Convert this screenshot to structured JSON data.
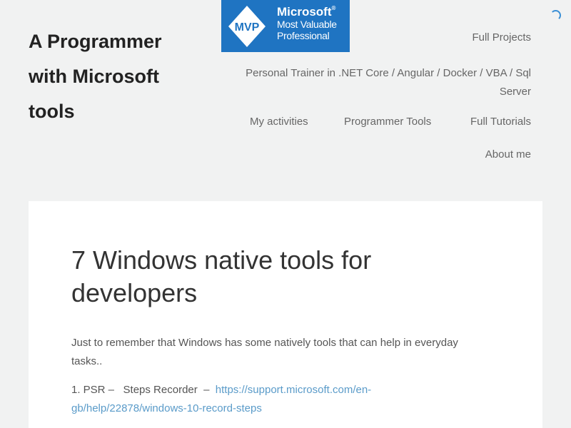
{
  "site": {
    "title": "A Programmer with Microsoft tools"
  },
  "badge": {
    "mvp": "MVP",
    "brand": "Microsoft",
    "reg": "®",
    "line1": "Most Valuable",
    "line2": "Professional",
    "color": "#1f74c2"
  },
  "nav": {
    "full_projects": "Full Projects",
    "trainer": "Personal Trainer in .NET Core / Angular / Docker / VBA / Sql Server",
    "my_activities": "My activities",
    "programmer_tools": "Programmer Tools",
    "full_tutorials": "Full Tutorials",
    "about_me": "About me"
  },
  "post": {
    "title": "7 Windows native tools for developers",
    "intro": "Just to remember that Windows has some natively tools that can help in everyday tasks..",
    "item1_prefix": "1. PSR –   Steps Recorder  –  ",
    "item1_link": "https://support.microsoft.com/en-gb/help/22878/windows-10-record-steps"
  },
  "colors": {
    "background": "#f1f2f2",
    "link": "#5a9bc9",
    "spinner": "#3a8fd6"
  }
}
